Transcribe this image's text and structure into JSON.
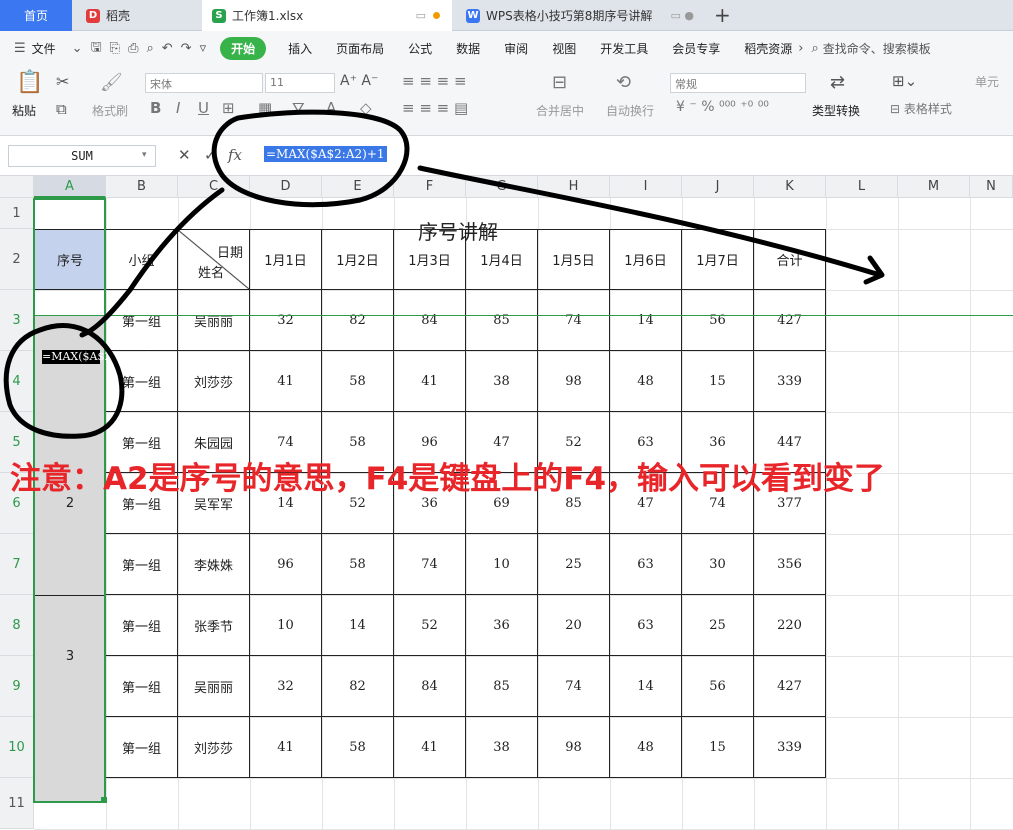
{
  "tabs": {
    "home": "首页",
    "daoke": "稻壳",
    "file": "工作簿1.xlsx",
    "doc": "WPS表格小技巧第8期序号讲解",
    "add": "+"
  },
  "menu": {
    "file": "文件",
    "items": [
      "开始",
      "插入",
      "页面布局",
      "公式",
      "数据",
      "审阅",
      "视图",
      "开发工具",
      "会员专享",
      "稻壳资源"
    ],
    "search": "查找命令、搜索模板"
  },
  "ribbon": {
    "paste": "粘贴",
    "format_painter": "格式刷",
    "font": "宋体",
    "size": "11",
    "merge": "合并居中",
    "wrap": "自动换行",
    "number_format": "常规",
    "type_convert": "类型转换",
    "table_style": "表格样式",
    "cell": "单元"
  },
  "formula_bar": {
    "name_box": "SUM",
    "formula": "=MAX($A$2:A2)+1",
    "fx": "fx"
  },
  "columns": [
    "A",
    "B",
    "C",
    "D",
    "E",
    "F",
    "G",
    "H",
    "I",
    "J",
    "K",
    "L",
    "M",
    "N"
  ],
  "rows": [
    "1",
    "2",
    "3",
    "4",
    "5",
    "6",
    "7",
    "8",
    "9",
    "10",
    "11"
  ],
  "sheet": {
    "title": "序号讲解",
    "headers": {
      "seq": "序号",
      "group": "小组",
      "date": "日期",
      "name": "姓名",
      "days": [
        "1月1日",
        "1月2日",
        "1月3日",
        "1月4日",
        "1月5日",
        "1月6日",
        "1月7日"
      ],
      "total": "合计"
    },
    "a3_edit": "=MAX($A$2:A2)+1",
    "seq_values": [
      "2",
      "3"
    ],
    "data": [
      {
        "group": "第一组",
        "name": "吴丽丽",
        "vals": [
          "32",
          "82",
          "84",
          "85",
          "74",
          "14",
          "56"
        ],
        "total": "427"
      },
      {
        "group": "第一组",
        "name": "刘莎莎",
        "vals": [
          "41",
          "58",
          "41",
          "38",
          "98",
          "48",
          "15"
        ],
        "total": "339"
      },
      {
        "group": "第一组",
        "name": "朱园园",
        "vals": [
          "74",
          "58",
          "96",
          "47",
          "52",
          "63",
          "36"
        ],
        "total": "447"
      },
      {
        "group": "第一组",
        "name": "吴军军",
        "vals": [
          "14",
          "52",
          "36",
          "69",
          "85",
          "47",
          "74"
        ],
        "total": "377"
      },
      {
        "group": "第一组",
        "name": "李姝姝",
        "vals": [
          "96",
          "58",
          "74",
          "10",
          "25",
          "63",
          "30"
        ],
        "total": "356"
      },
      {
        "group": "第一组",
        "name": "张季节",
        "vals": [
          "10",
          "14",
          "52",
          "36",
          "20",
          "63",
          "25"
        ],
        "total": "220"
      },
      {
        "group": "第一组",
        "name": "吴丽丽",
        "vals": [
          "32",
          "82",
          "84",
          "85",
          "74",
          "14",
          "56"
        ],
        "total": "427"
      },
      {
        "group": "第一组",
        "name": "刘莎莎",
        "vals": [
          "41",
          "58",
          "41",
          "38",
          "98",
          "48",
          "15"
        ],
        "total": "339"
      }
    ]
  },
  "annotation": "注意：A2是序号的意思，F4是键盘上的F4，输入可以看到变了",
  "colors": {
    "accent": "#37b34a",
    "selection": "#2d9a4a",
    "note": "#e8262a",
    "tab_home": "#3b77f0"
  }
}
